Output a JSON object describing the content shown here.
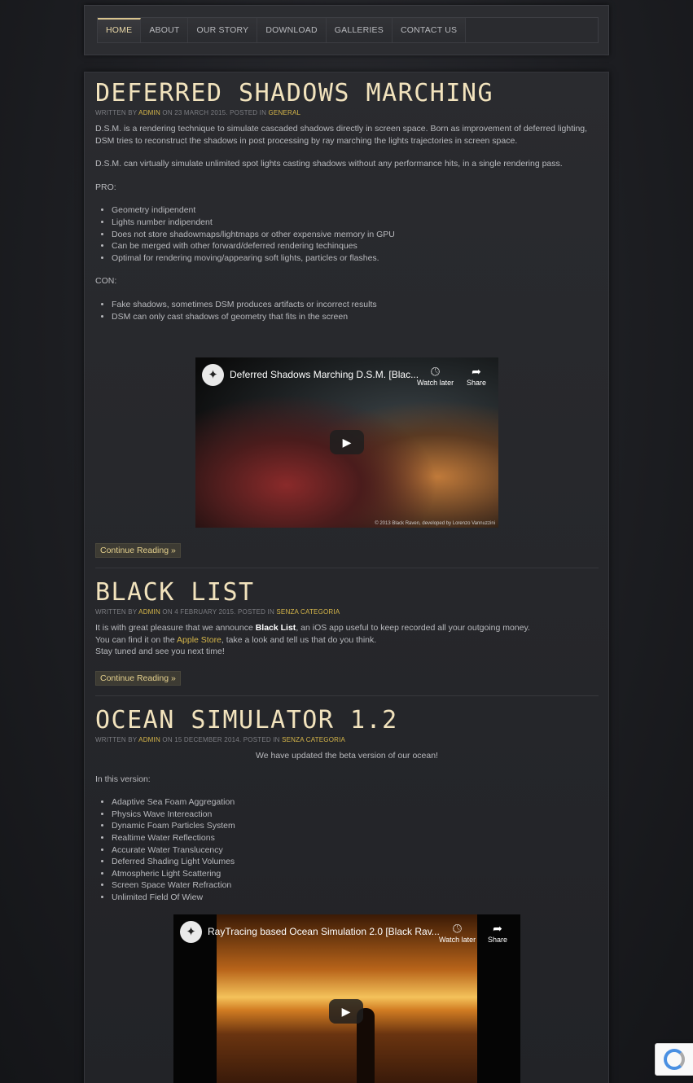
{
  "nav": {
    "items": [
      "HOME",
      "ABOUT",
      "OUR STORY",
      "DOWNLOAD",
      "GALLERIES",
      "CONTACT US"
    ],
    "active": "HOME"
  },
  "posts": [
    {
      "title": "DEFERRED SHADOWS MARCHING",
      "meta": {
        "written_by": "WRITTEN BY",
        "author": "ADMIN",
        "on": "ON 23 MARCH 2015. POSTED IN",
        "category": "GENERAL"
      },
      "intro": "D.S.M. is a rendering technique to simulate cascaded shadows directly in screen space. Born as improvement of deferred lighting, DSM tries to reconstruct the shadows in post processing by ray marching the lights trajectories in screen space.",
      "para2": "D.S.M. can virtually simulate unlimited spot lights casting shadows without any performance hits, in a single rendering pass.",
      "pro_label": "PRO:",
      "pros": [
        "Geometry indipendent",
        "Lights number indipendent",
        "Does not store shadowmaps/lightmaps or other expensive memory in GPU",
        "Can be merged with other forward/deferred rendering techinques",
        "Optimal for rendering moving/appearing soft lights, particles or flashes."
      ],
      "con_label": "CON:",
      "cons": [
        "Fake shadows, sometimes DSM produces artifacts or incorrect results",
        "DSM can only cast shadows of geometry that fits in the screen"
      ],
      "video": {
        "title": "Deferred Shadows Marching D.S.M. [Blac...",
        "watch_later": "Watch later",
        "share": "Share",
        "credit": "© 2013 Black Raven, developed by Lorenzo Vannuzzini"
      },
      "continue": "Continue Reading »"
    },
    {
      "title": "BLACK LIST",
      "meta": {
        "written_by": "WRITTEN BY",
        "author": "ADMIN",
        "on": "ON 4 FEBRUARY 2015. POSTED IN",
        "category": "SENZA CATEGORIA"
      },
      "line1_pre": "It is with great pleasure that we announce ",
      "line1_bold": "Black List",
      "line1_post": ", an iOS app useful to keep recorded all your outgoing money.",
      "line2_pre": "You can find it on the ",
      "line2_link": "Apple Store",
      "line2_post": ", take a look and tell us that do you think.",
      "line3": "Stay tuned and see you next time!",
      "continue": "Continue Reading »"
    },
    {
      "title": "OCEAN SIMULATOR 1.2",
      "meta": {
        "written_by": "WRITTEN BY",
        "author": "ADMIN",
        "on": "ON 15 DECEMBER 2014. POSTED IN",
        "category": "SENZA CATEGORIA"
      },
      "centered": "We have updated the beta version of our ocean!",
      "version_label": "In this version:",
      "features": [
        "Adaptive Sea Foam Aggregation",
        "Physics Wave Intereaction",
        "Dynamic Foam Particles System",
        "Realtime Water Reflections",
        "Accurate Water Translucency",
        "Deferred Shading Light Volumes",
        "Atmospheric Light Scattering",
        "Screen Space Water Refraction",
        "Unlimited Field Of Wiew"
      ],
      "video": {
        "title": "RayTracing based Ocean Simulation 2.0 [Black Rav...",
        "watch_later": "Watch later",
        "share": "Share"
      }
    }
  ]
}
